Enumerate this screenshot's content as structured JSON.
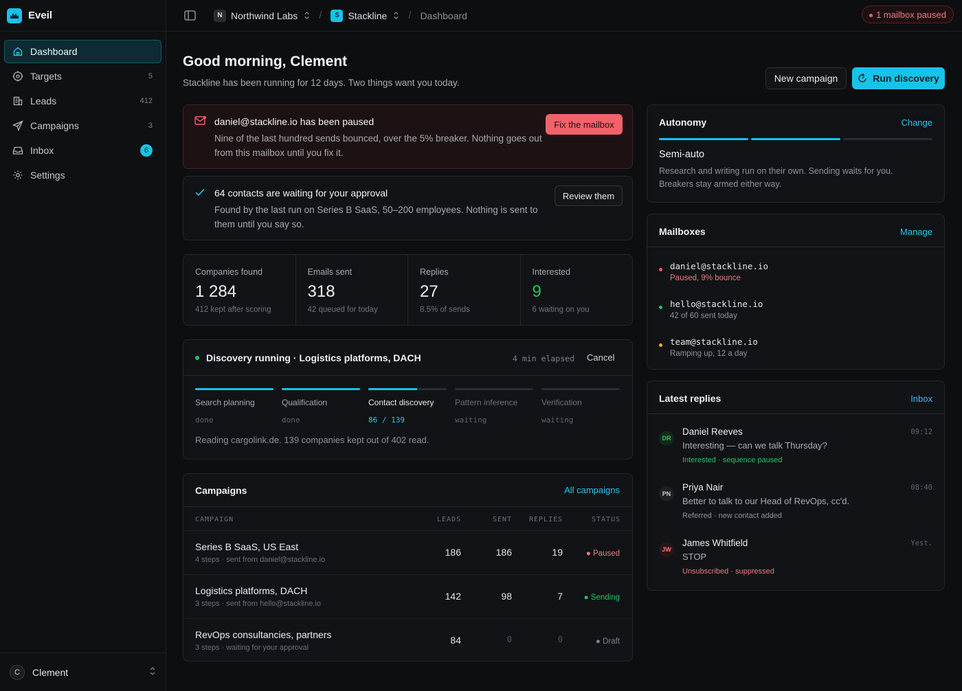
{
  "app": {
    "name": "Eveil"
  },
  "sidebar": {
    "items": [
      {
        "label": "Dashboard",
        "count": ""
      },
      {
        "label": "Targets",
        "count": "5"
      },
      {
        "label": "Leads",
        "count": "412"
      },
      {
        "label": "Campaigns",
        "count": "3"
      },
      {
        "label": "Inbox",
        "badge": "6"
      },
      {
        "label": "Settings",
        "count": ""
      }
    ],
    "user": {
      "initial": "C",
      "name": "Clement"
    }
  },
  "topbar": {
    "org": {
      "chip": "N",
      "name": "Northwind Labs"
    },
    "workspace": {
      "chip": "S",
      "name": "Stackline"
    },
    "page": "Dashboard",
    "status_pill": "1 mailbox paused"
  },
  "header": {
    "greeting": "Good morning, Clement",
    "subtitle": "Stackline has been running for 12 days. Two things want you today.",
    "new_campaign": "New campaign",
    "run_discovery": "Run discovery"
  },
  "alerts": {
    "paused": {
      "title": "daniel@stackline.io has been paused",
      "body": "Nine of the last hundred sends bounced, over the 5% breaker. Nothing goes out from this mailbox until you fix it.",
      "action": "Fix the mailbox"
    },
    "approval": {
      "title": "64 contacts are waiting for your approval",
      "body": "Found by the last run on Series B SaaS, 50–200 employees. Nothing is sent to them until you say so.",
      "action": "Review them"
    }
  },
  "stats": [
    {
      "label": "Companies found",
      "value": "1 284",
      "sub": "412 kept after scoring"
    },
    {
      "label": "Emails sent",
      "value": "318",
      "sub": "42 queued for today"
    },
    {
      "label": "Replies",
      "value": "27",
      "sub": "8.5% of sends"
    },
    {
      "label": "Interested",
      "value": "9",
      "sub": "6 waiting on you"
    }
  ],
  "discovery": {
    "title": "Discovery running · Logistics platforms, DACH",
    "elapsed": "4 min elapsed",
    "cancel": "Cancel",
    "steps": [
      {
        "name": "Search planning",
        "state": "done",
        "progress": 1.0
      },
      {
        "name": "Qualification",
        "state": "done",
        "progress": 1.0
      },
      {
        "name": "Contact discovery",
        "state": "86 / 139",
        "progress": 0.62
      },
      {
        "name": "Pattern inference",
        "state": "waiting",
        "progress": 0
      },
      {
        "name": "Verification",
        "state": "waiting",
        "progress": 0
      }
    ],
    "footer": "Reading cargolink.de. 139 companies kept out of 402 read."
  },
  "campaigns": {
    "title": "Campaigns",
    "all_link": "All campaigns",
    "headers": {
      "campaign": "CAMPAIGN",
      "leads": "LEADS",
      "sent": "SENT",
      "replies": "REPLIES",
      "status": "STATUS"
    },
    "rows": [
      {
        "name": "Series B SaaS, US East",
        "sub": "4 steps · sent from daniel@stackline.io",
        "leads": "186",
        "sent": "186",
        "replies": "19",
        "status": "Paused"
      },
      {
        "name": "Logistics platforms, DACH",
        "sub": "3 steps · sent from hello@stackline.io",
        "leads": "142",
        "sent": "98",
        "replies": "7",
        "status": "Sending"
      },
      {
        "name": "RevOps consultancies, partners",
        "sub": "3 steps · waiting for your approval",
        "leads": "84",
        "sent": "0",
        "replies": "0",
        "status": "Draft"
      }
    ]
  },
  "autonomy": {
    "title": "Autonomy",
    "change": "Change",
    "mode": "Semi-auto",
    "level": 2,
    "levels_total": 3,
    "desc": "Research and writing run on their own. Sending waits for you. Breakers stay armed either way."
  },
  "mailboxes": {
    "title": "Mailboxes",
    "manage": "Manage",
    "items": [
      {
        "address": "daniel@stackline.io",
        "sub": "Paused, 9% bounce",
        "color": "#ef5a61"
      },
      {
        "address": "hello@stackline.io",
        "sub": "42 of 60 sent today",
        "color": "#22c55e"
      },
      {
        "address": "team@stackline.io",
        "sub": "Ramping up, 12 a day",
        "color": "#eab308"
      }
    ]
  },
  "replies": {
    "title": "Latest replies",
    "inbox": "Inbox",
    "items": [
      {
        "initials": "DR",
        "name": "Daniel Reeves",
        "time": "09:12",
        "message": "Interesting — can we talk Thursday?",
        "tag": "Interested · sequence paused"
      },
      {
        "initials": "PN",
        "name": "Priya Nair",
        "time": "08:40",
        "message": "Better to talk to our Head of RevOps, cc'd.",
        "tag": "Referred · new contact added"
      },
      {
        "initials": "JW",
        "name": "James Whitfield",
        "time": "Yest.",
        "message": "STOP",
        "tag": "Unsubscribed · suppressed"
      }
    ]
  }
}
